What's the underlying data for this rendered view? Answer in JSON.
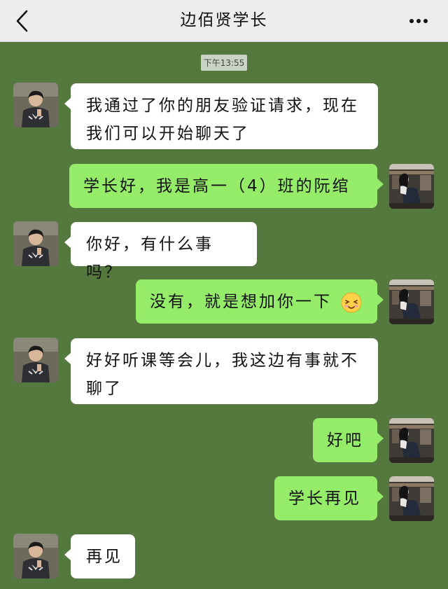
{
  "header": {
    "title": "边佰贤学长",
    "back_icon": "chevron-left-icon",
    "more_icon": "more-dots-icon"
  },
  "timestamp": "下午13:55",
  "colors": {
    "chat_background": "#55783f",
    "incoming_bubble": "#ffffff",
    "outgoing_bubble": "#95ec69",
    "header_background": "#ededed"
  },
  "messages": [
    {
      "side": "in",
      "text": "我通过了你的朋友验证请求，现在我们可以开始聊天了"
    },
    {
      "side": "out",
      "text": "学长好，我是高一（4）班的阮绾"
    },
    {
      "side": "in",
      "text": "你好，有什么事吗？"
    },
    {
      "side": "out",
      "text": "没有，就是想加你一下",
      "emoji": "blush-smile-emoji"
    },
    {
      "side": "in",
      "text": "好好听课等会儿，我这边有事就不聊了"
    },
    {
      "side": "out",
      "text": "好吧"
    },
    {
      "side": "out",
      "text": "学长再见"
    },
    {
      "side": "in",
      "text": "再见"
    }
  ]
}
